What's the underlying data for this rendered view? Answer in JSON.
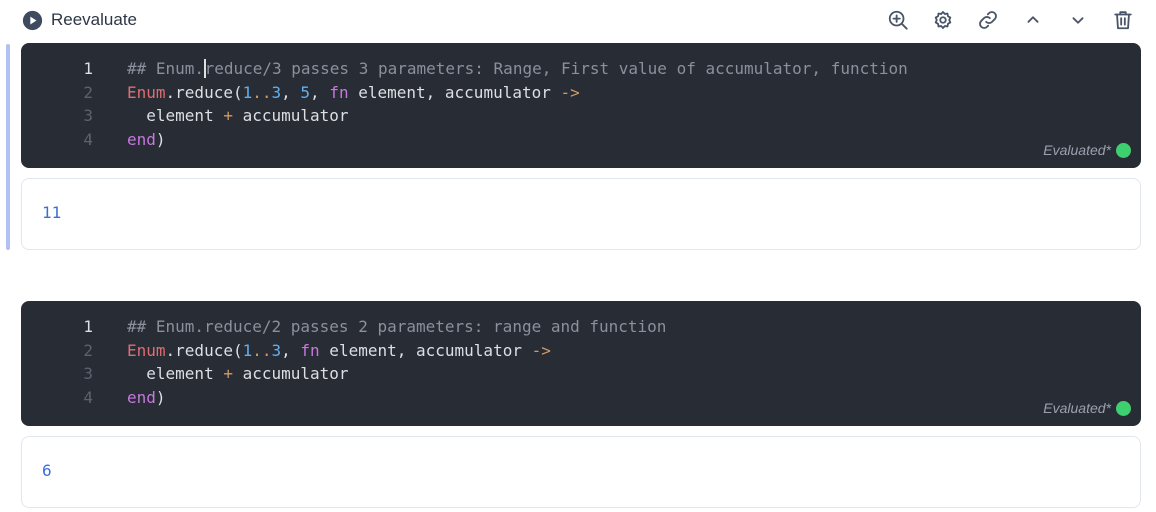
{
  "toolbar": {
    "reevaluate_label": "Reevaluate",
    "actions": [
      {
        "icon": "zoom-in-icon"
      },
      {
        "icon": "gear-icon"
      },
      {
        "icon": "link-icon"
      },
      {
        "icon": "chevron-up-icon"
      },
      {
        "icon": "chevron-down-icon"
      },
      {
        "icon": "trash-icon"
      }
    ]
  },
  "colors": {
    "editor_bg": "#282c34",
    "evaluated_dot": "#3ecf6e",
    "output_text": "#3b6fd6",
    "focus_bar": "#b3c1f2"
  },
  "cells": [
    {
      "lines": [
        {
          "number": "1",
          "tokens": [
            {
              "t": "## Enum.",
              "c": "comment"
            },
            {
              "cursor": true
            },
            {
              "t": "reduce/3 passes 3 parameters: Range, First value of accumulator, function",
              "c": "comment"
            }
          ]
        },
        {
          "number": "2",
          "tokens": [
            {
              "t": "Enum",
              "c": "module"
            },
            {
              "t": ".reduce(",
              "c": "text"
            },
            {
              "t": "1",
              "c": "num"
            },
            {
              "t": "..",
              "c": "op"
            },
            {
              "t": "3",
              "c": "num"
            },
            {
              "t": ", ",
              "c": "text"
            },
            {
              "t": "5",
              "c": "num"
            },
            {
              "t": ", ",
              "c": "text"
            },
            {
              "t": "fn",
              "c": "kw"
            },
            {
              "t": " element, accumulator ",
              "c": "text"
            },
            {
              "t": "->",
              "c": "op"
            }
          ]
        },
        {
          "number": "3",
          "tokens": [
            {
              "t": "  element ",
              "c": "text"
            },
            {
              "t": "+",
              "c": "op"
            },
            {
              "t": " accumulator",
              "c": "text"
            }
          ]
        },
        {
          "number": "4",
          "tokens": [
            {
              "t": "end",
              "c": "kw"
            },
            {
              "t": ")",
              "c": "text"
            }
          ]
        }
      ],
      "status": "Evaluated*",
      "output": "11"
    },
    {
      "lines": [
        {
          "number": "1",
          "tokens": [
            {
              "t": "## Enum.reduce/2 passes 2 parameters: range and function",
              "c": "comment"
            }
          ]
        },
        {
          "number": "2",
          "tokens": [
            {
              "t": "Enum",
              "c": "module"
            },
            {
              "t": ".reduce(",
              "c": "text"
            },
            {
              "t": "1",
              "c": "num"
            },
            {
              "t": "..",
              "c": "op"
            },
            {
              "t": "3",
              "c": "num"
            },
            {
              "t": ", ",
              "c": "text"
            },
            {
              "t": "fn",
              "c": "kw"
            },
            {
              "t": " element, accumulator ",
              "c": "text"
            },
            {
              "t": "->",
              "c": "op"
            }
          ]
        },
        {
          "number": "3",
          "tokens": [
            {
              "t": "  element ",
              "c": "text"
            },
            {
              "t": "+",
              "c": "op"
            },
            {
              "t": " accumulator",
              "c": "text"
            }
          ]
        },
        {
          "number": "4",
          "tokens": [
            {
              "t": "end",
              "c": "kw"
            },
            {
              "t": ")",
              "c": "text"
            }
          ]
        }
      ],
      "status": "Evaluated*",
      "output": "6"
    }
  ]
}
